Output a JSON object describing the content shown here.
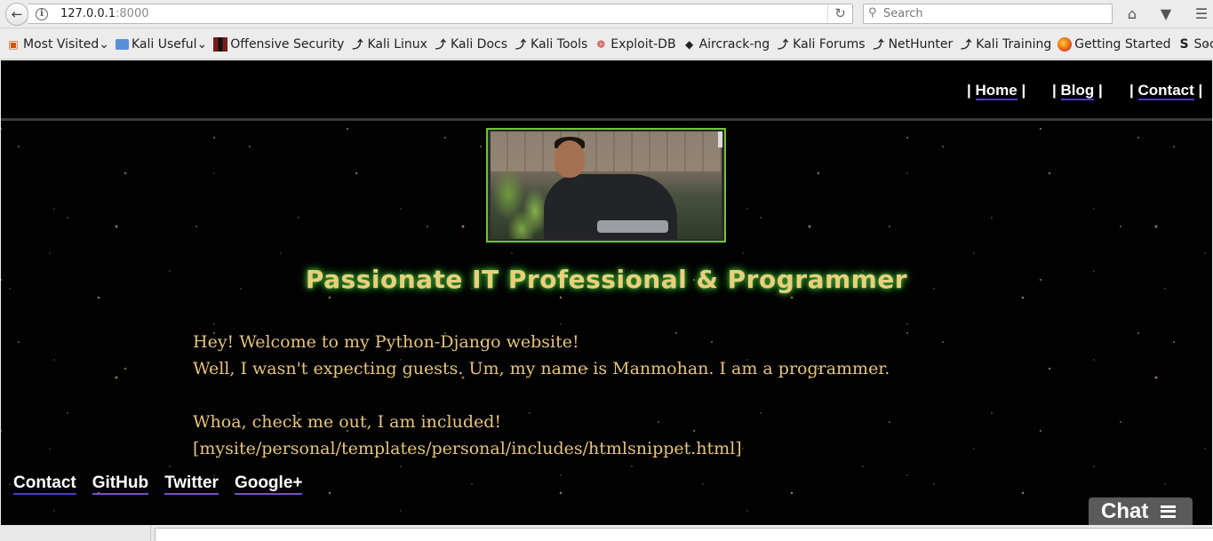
{
  "browser": {
    "url_host": "127.0.0.1",
    "url_port": ":8000",
    "search_placeholder": "Search"
  },
  "bookmarks": [
    {
      "label": "Most Visited",
      "icon": "most-visited-icon",
      "dropdown": true
    },
    {
      "label": "Kali Useful",
      "icon": "folder-icon",
      "dropdown": true
    },
    {
      "label": "Offensive Security",
      "icon": "offsec-icon"
    },
    {
      "label": "Kali Linux",
      "icon": "kali-dragon-icon"
    },
    {
      "label": "Kali Docs",
      "icon": "kali-dragon-icon"
    },
    {
      "label": "Kali Tools",
      "icon": "kali-dragon-icon"
    },
    {
      "label": "Exploit-DB",
      "icon": "exploit-db-icon"
    },
    {
      "label": "Aircrack-ng",
      "icon": "aircrack-icon"
    },
    {
      "label": "Kali Forums",
      "icon": "kali-dragon-icon"
    },
    {
      "label": "NetHunter",
      "icon": "kali-dragon-icon"
    },
    {
      "label": "Kali Training",
      "icon": "kali-dragon-icon"
    },
    {
      "label": "Getting Started",
      "icon": "firefox-icon"
    },
    {
      "label": "Soovle",
      "icon": "soovle-icon"
    }
  ],
  "nav": {
    "home": "Home",
    "blog": "Blog",
    "contact": "Contact",
    "separator": "|"
  },
  "hero": {
    "headline": "Passionate IT Professional & Programmer"
  },
  "intro": {
    "line1": "Hey! Welcome to my Python-Django website!",
    "line2": "Well, I wasn't expecting guests. Um, my name is Manmohan. I am a programmer.",
    "line3": "Whoa, check me out, I am included!",
    "line4": "[mysite/personal/templates/personal/includes/htmlsnippet.html]"
  },
  "footer": {
    "links": [
      "Contact",
      "GitHub",
      "Twitter",
      "Google+"
    ]
  },
  "chat": {
    "label": "Chat"
  },
  "colors": {
    "headline": "#e9cf7c",
    "headline_glow": "#3b9e34",
    "body_text": "#e5c47c",
    "photo_border": "#6fc23a",
    "link_underline": "#4b3cc4"
  }
}
